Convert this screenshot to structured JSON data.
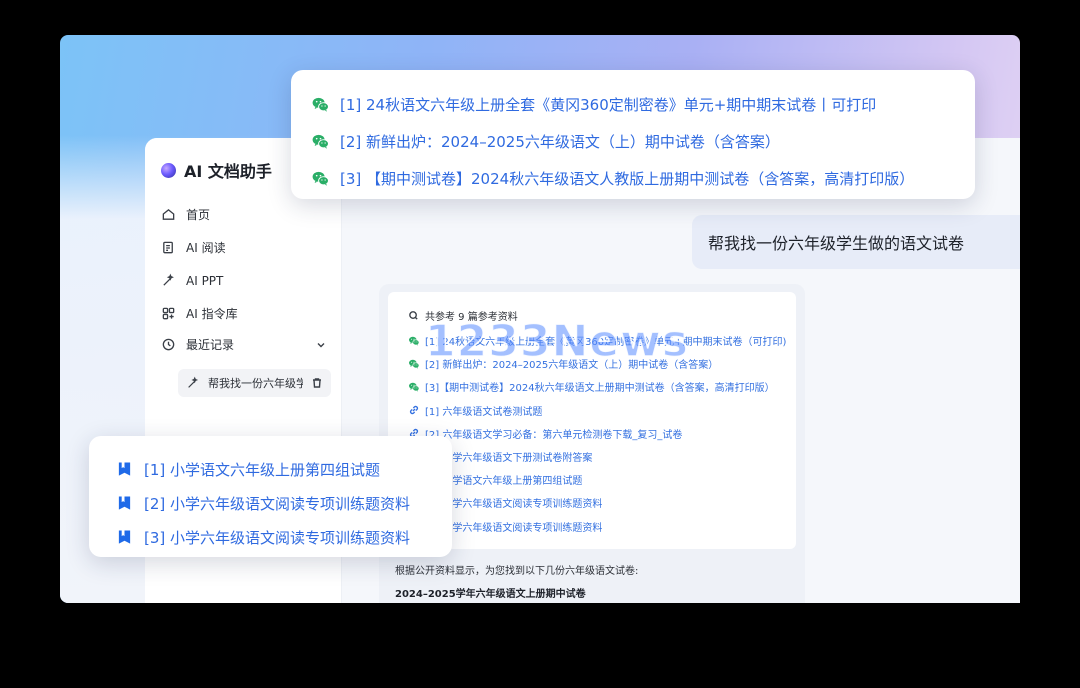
{
  "app": {
    "title": "AI 文档助手"
  },
  "sidebar": {
    "items": [
      {
        "label": "首页",
        "icon": "home-icon"
      },
      {
        "label": "AI 阅读",
        "icon": "reading-icon"
      },
      {
        "label": "AI PPT",
        "icon": "magic-wand-icon"
      },
      {
        "label": "AI 指令库",
        "icon": "library-icon"
      }
    ],
    "recent_label": "最近记录",
    "recent_item": "帮我找一份六年级学生做的语文试卷"
  },
  "chat": {
    "user_message": "帮我找一份六年级学生做的语文试卷",
    "refs_header": "共参考 9 篇参考资料",
    "refs": [
      {
        "text": "[1] 24秋语文六年级上册全套《黄冈360定制密卷》单元+期中期末试卷（可打印)",
        "type": "wechat"
      },
      {
        "text": "[2] 新鲜出炉：2024–2025六年级语文（上）期中试卷（含答案）",
        "type": "wechat"
      },
      {
        "text": "[3]【期中测试卷】2024秋六年级语文上册期中测试卷（含答案，高清打印版）",
        "type": "wechat"
      },
      {
        "text": "[1] 六年级语文试卷测试题",
        "type": "link"
      },
      {
        "text": "[2] 六年级语文学习必备：第六单元检测卷下载_复习_试卷",
        "type": "link"
      },
      {
        "text": "[1] 小学六年级语文下册测试卷附答案",
        "type": "doc"
      },
      {
        "text": "[2] 小学语文六年级上册第四组试题",
        "type": "doc"
      },
      {
        "text": "[3] 小学六年级语文阅读专项训练题资料",
        "type": "doc"
      },
      {
        "text": "[4] 小学六年级语文阅读专项训练题资料",
        "type": "doc"
      }
    ],
    "answer_intro": "根据公开资料显示，为您找到以下几份六年级语文试卷:",
    "answer_heading": "2024–2025学年六年级语文上册期中试卷"
  },
  "popup_top": {
    "items": [
      "[1] 24秋语文六年级上册全套《黄冈360定制密卷》单元+期中期末试卷丨可打印",
      "[2] 新鲜出炉：2024–2025六年级语文（上）期中试卷（含答案）",
      "[3] 【期中测试卷】2024秋六年级语文人教版上册期中测试卷（含答案，高清打印版）"
    ]
  },
  "popup_left": {
    "items": [
      "[1] 小学语文六年级上册第四组试题",
      "[2] 小学六年级语文阅读专项训练题资料",
      "[3] 小学六年级语文阅读专项训练题资料"
    ]
  },
  "watermark": "1233News",
  "colors": {
    "link": "#3370e0",
    "wechat": "#2aae67",
    "doc": "#2f6ae0"
  }
}
